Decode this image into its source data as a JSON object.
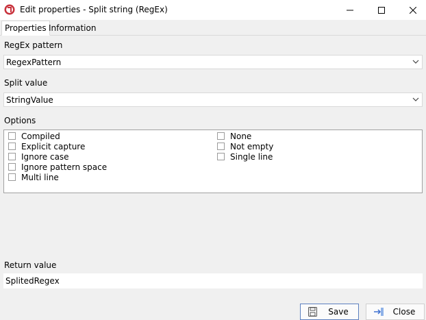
{
  "window": {
    "title": "Edit properties - Split string (RegEx)"
  },
  "tabs": [
    {
      "label": "Properties",
      "active": true
    },
    {
      "label": "Information",
      "active": false
    }
  ],
  "regex_pattern": {
    "label": "RegEx pattern",
    "value": "RegexPattern"
  },
  "split_value": {
    "label": "Split value",
    "value": "StringValue"
  },
  "options": {
    "label": "Options",
    "left": [
      {
        "label": "Compiled",
        "checked": false
      },
      {
        "label": "Explicit capture",
        "checked": false
      },
      {
        "label": "Ignore case",
        "checked": false
      },
      {
        "label": "Ignore pattern space",
        "checked": false
      },
      {
        "label": "Multi line",
        "checked": false
      }
    ],
    "right": [
      {
        "label": "None",
        "checked": false
      },
      {
        "label": "Not empty",
        "checked": false
      },
      {
        "label": "Single line",
        "checked": false
      }
    ]
  },
  "return_value": {
    "label": "Return value",
    "value": "SplitedRegex"
  },
  "buttons": {
    "save": "Save",
    "close": "Close"
  },
  "colors": {
    "app_icon": "#c8323c",
    "save_border": "#5b7fbf"
  }
}
